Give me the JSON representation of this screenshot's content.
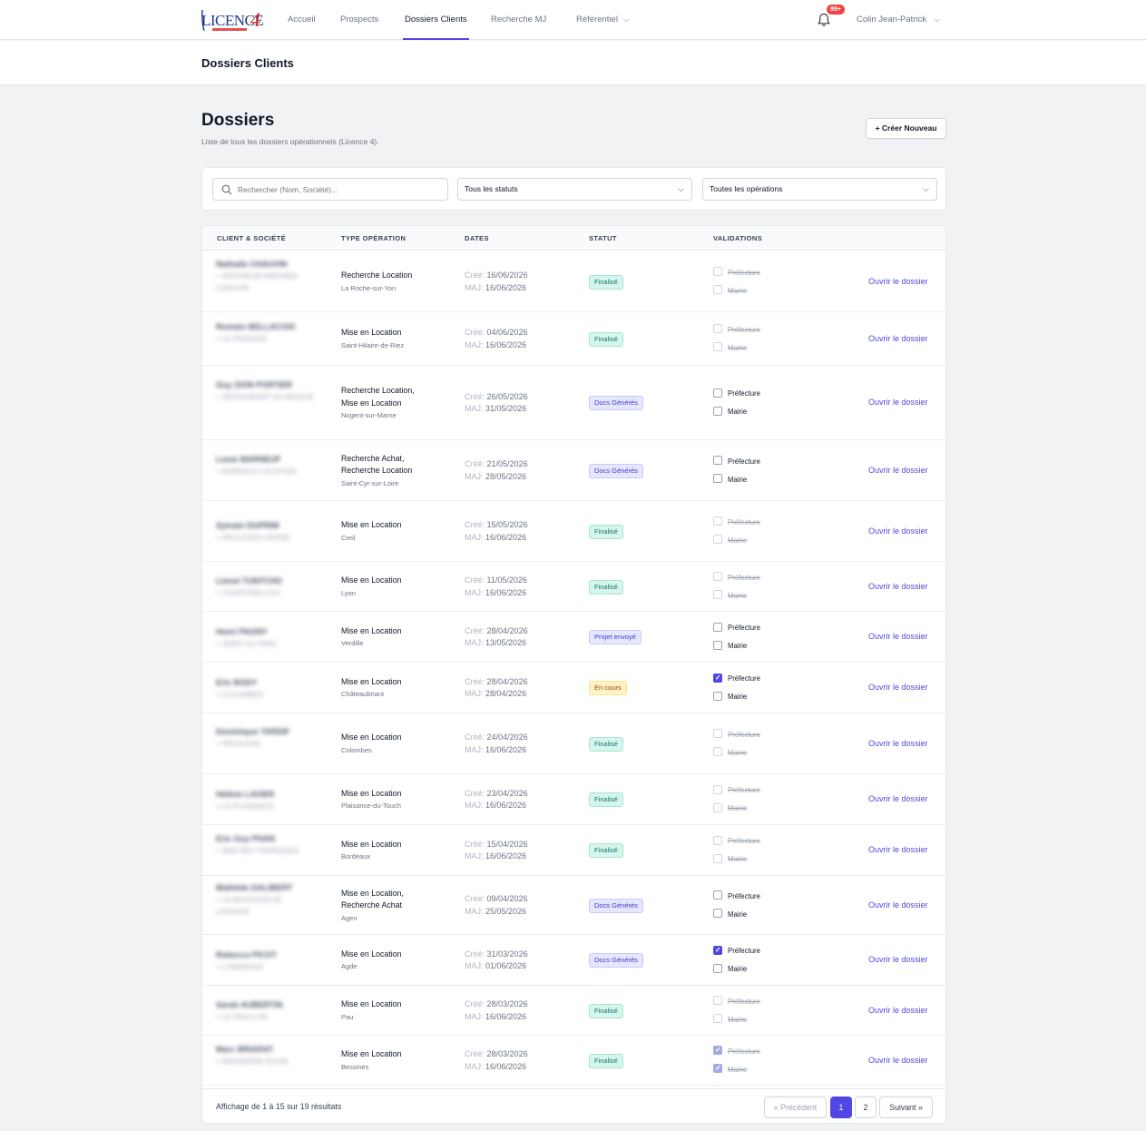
{
  "nav": {
    "logo_text": "LICENCE4",
    "links": [
      "Accueil",
      "Prospects",
      "Dossiers Clients",
      "Recherche MJ",
      "Référentiel"
    ],
    "notif_count": "99+",
    "user_name": "Colin Jean-Patrick"
  },
  "pagebar": {
    "title": "Dossiers Clients"
  },
  "section": {
    "title": "Dossiers",
    "subtitle": "Liste de tous les dossiers opérationnels (Licence 4).",
    "create_label": "+ Créer Nouveau"
  },
  "filters": {
    "search_placeholder": "Rechercher (Nom, Société)...",
    "status_selected": "Tous les statuts",
    "operation_selected": "Toutes les opérations"
  },
  "table": {
    "headers": [
      "CLIENT & SOCIÉTÉ",
      "TYPE OPÉRATION",
      "DATES",
      "STATUT",
      "VALIDATIONS"
    ],
    "created_label": "Créé:",
    "updated_label": "MAJ:",
    "pref_label": "Préfecture",
    "mairie_label": "Mairie",
    "open_label": "Ouvrir le dossier",
    "rows": [
      {
        "client": "Nathalie CHAUVIN",
        "company": "+ INTERIEUR PARTNER CHAUVIN",
        "op": [
          "Recherche Location"
        ],
        "city": "La Roche-sur-Yon",
        "created": "16/06/2026",
        "updated": "16/06/2026",
        "status": "Finalisé",
        "pref": "done",
        "mairie": "done"
      },
      {
        "client": "Romain BELLACOIX",
        "company": "+ LE PASSAGE",
        "op": [
          "Mise en Location"
        ],
        "city": "Saint-Hilaire-de-Riez",
        "created": "04/06/2026",
        "updated": "16/06/2026",
        "status": "Finalisé",
        "pref": "done",
        "mairie": "done"
      },
      {
        "client": "Guy ZION PORTIER",
        "company": "+ RESTAURANT DU MOULIN",
        "op": [
          "Recherche Location,",
          "Mise en Location"
        ],
        "city": "Nogent-sur-Marne",
        "created": "26/05/2026",
        "updated": "31/05/2026",
        "status": "Docs Générés",
        "pref": "open",
        "mairie": "open"
      },
      {
        "client": "Louis MARNEUF",
        "company": "+ BUREAUX LOCATION",
        "op": [
          "Recherche Achat,",
          "Recherche Location"
        ],
        "city": "Saint-Cyr-sur-Loire",
        "created": "21/05/2026",
        "updated": "28/05/2026",
        "status": "Docs Générés",
        "pref": "open",
        "mairie": "open"
      },
      {
        "client": "Sylvain DUPRIM",
        "company": "+ ARCLOUES GRAND",
        "op": [
          "Mise en Location"
        ],
        "city": "Creil",
        "created": "15/05/2026",
        "updated": "16/06/2026",
        "status": "Finalisé",
        "pref": "done",
        "mairie": "done"
      },
      {
        "client": "Lionel TUNTCHO",
        "company": "+ TOURTERELLES",
        "op": [
          "Mise en Location"
        ],
        "city": "Lyon",
        "created": "11/05/2026",
        "updated": "16/06/2026",
        "status": "Finalisé",
        "pref": "done",
        "mairie": "done"
      },
      {
        "client": "Henri PAGNY",
        "company": "+ SAINT DU PARC",
        "op": [
          "Mise en Location"
        ],
        "city": "Verdille",
        "created": "28/04/2026",
        "updated": "13/05/2026",
        "status": "Projet envoyé",
        "pref": "open",
        "mairie": "open"
      },
      {
        "client": "Eric BODY",
        "company": "+ COLOMBES",
        "op": [
          "Mise en Location"
        ],
        "city": "Châteaubriant",
        "created": "28/04/2026",
        "updated": "28/04/2026",
        "status": "En cours",
        "pref": "checked",
        "mairie": "open"
      },
      {
        "client": "Dominique TARDIF",
        "company": "+ PRIVILEGE",
        "op": [
          "Mise en Location"
        ],
        "city": "Colombes",
        "created": "24/04/2026",
        "updated": "16/06/2026",
        "status": "Finalisé",
        "pref": "done",
        "mairie": "done"
      },
      {
        "client": "Hélène LAVIER",
        "company": "+ LE PLAISANCE",
        "op": [
          "Mise en Location"
        ],
        "city": "Plaisance-du-Touch",
        "created": "23/04/2026",
        "updated": "16/06/2026",
        "status": "Finalisé",
        "pref": "done",
        "mairie": "done"
      },
      {
        "client": "Eric Guy PHAN",
        "company": "+ BAR DES TROPIQUES",
        "op": [
          "Mise en Location"
        ],
        "city": "Bordeaux",
        "created": "15/04/2026",
        "updated": "16/06/2026",
        "status": "Finalisé",
        "pref": "done",
        "mairie": "done"
      },
      {
        "client": "Mathilde DALIBERT",
        "company": "+ LE BOUCHON DE LASSAGE",
        "op": [
          "Mise en Location,",
          "Recherche Achat"
        ],
        "city": "Agen",
        "created": "09/04/2026",
        "updated": "25/05/2026",
        "status": "Docs Générés",
        "pref": "open",
        "mairie": "open"
      },
      {
        "client": "Rebecca PICOT",
        "company": "+ L'AMARAGE",
        "op": [
          "Mise en Location"
        ],
        "city": "Agde",
        "created": "31/03/2026",
        "updated": "01/06/2026",
        "status": "Docs Générés",
        "pref": "checked",
        "mairie": "open"
      },
      {
        "client": "Sarah AUBERTIN",
        "company": "+ LE PAVILLON",
        "op": [
          "Mise en Location"
        ],
        "city": "Pau",
        "created": "28/03/2026",
        "updated": "16/06/2026",
        "status": "Finalisé",
        "pref": "done",
        "mairie": "done"
      },
      {
        "client": "Marc BRIARAT",
        "company": "+ BRASSERIE DUVAL",
        "op": [
          "Mise en Location"
        ],
        "city": "Bessines",
        "created": "28/03/2026",
        "updated": "16/06/2026",
        "status": "Finalisé",
        "pref": "done-checked",
        "mairie": "done-checked"
      }
    ]
  },
  "pagination": {
    "summary": "Affichage de 1 à 15 sur 19 résultats",
    "prev": "« Précédent",
    "pages": [
      "1",
      "2"
    ],
    "next": "Suivant »"
  },
  "colors": {
    "accent": "#4f46e5",
    "green_badge": "#d6f5ec",
    "purple_badge": "#e5e7ff",
    "yellow_badge": "#fef3c7",
    "notif_badge": "#ef4444"
  }
}
